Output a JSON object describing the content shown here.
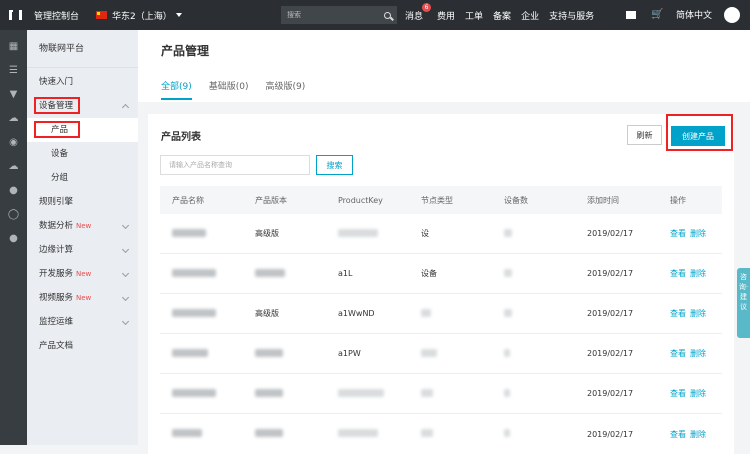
{
  "topbar": {
    "title": "管理控制台",
    "region": "华东2（上海）",
    "search_placeholder": "搜索",
    "nav": [
      {
        "label": "消息",
        "badge": "6"
      },
      {
        "label": "费用"
      },
      {
        "label": "工单"
      },
      {
        "label": "备案"
      },
      {
        "label": "企业"
      },
      {
        "label": "支持与服务"
      }
    ],
    "language": "简体中文"
  },
  "sidebar": {
    "title": "物联网平台",
    "quick": "快速入门",
    "device_mgmt": "设备管理",
    "sub": {
      "product": "产品",
      "device": "设备",
      "group": "分组"
    },
    "rules": "规则引擎",
    "analysis": "数据分析",
    "new_label": "New",
    "edge": "边缘计算",
    "dev": "开发服务",
    "video": "视频服务",
    "ops": "监控运维",
    "docs": "产品文档"
  },
  "main": {
    "title": "产品管理",
    "tabs": [
      "全部(9)",
      "基础版(0)",
      "高级版(9)"
    ],
    "list_title": "产品列表",
    "refresh": "刷新",
    "create": "创建产品",
    "search_placeholder": "请输入产品名称查询",
    "search_btn": "搜索",
    "columns": [
      "产品名称",
      "产品版本",
      "ProductKey",
      "节点类型",
      "设备数",
      "添加时间",
      "操作"
    ],
    "rows": [
      {
        "version": "高级版",
        "key": "",
        "node": "设",
        "date": "2019/02/17"
      },
      {
        "version": "",
        "key": "a1L",
        "node": "设备",
        "date": "2019/02/17"
      },
      {
        "version": "高级版",
        "key": "a1WwND",
        "node": "",
        "date": "2019/02/17"
      },
      {
        "version": "",
        "key": "a1PW",
        "node": "",
        "date": "2019/02/17"
      },
      {
        "version": "",
        "key": "",
        "node": "",
        "date": "2019/02/17"
      },
      {
        "version": "",
        "key": "",
        "node": "",
        "date": "2019/02/17"
      }
    ],
    "view": "查看",
    "delete": "删除"
  },
  "float_tab": "咨询·建议"
}
